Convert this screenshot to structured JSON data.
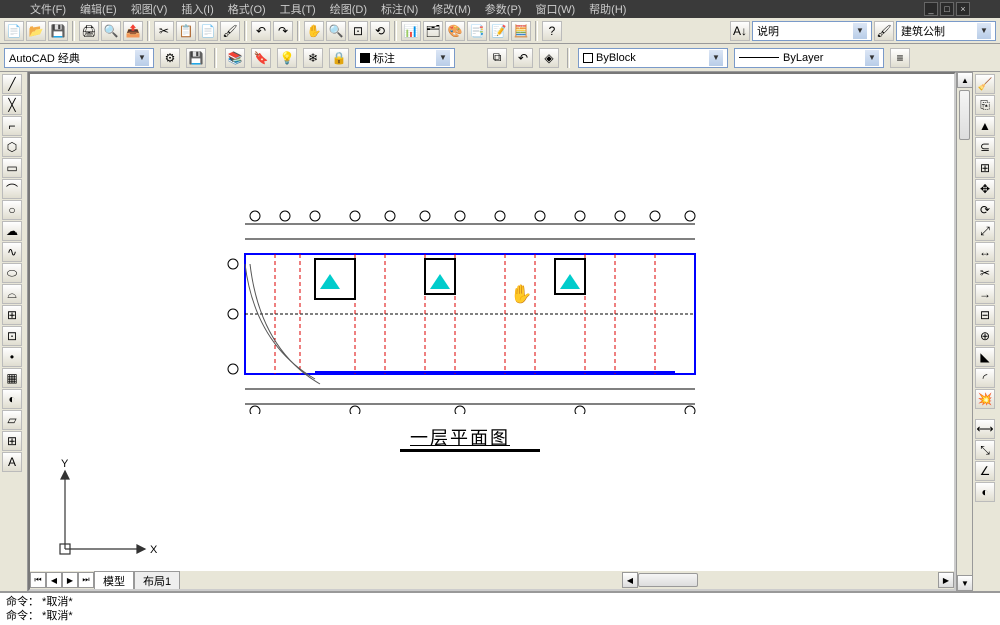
{
  "menu": {
    "file": "文件(F)",
    "edit": "编辑(E)",
    "view": "视图(V)",
    "insert": "插入(I)",
    "format": "格式(O)",
    "tools": "工具(T)",
    "draw": "绘图(D)",
    "dimension": "标注(N)",
    "modify": "修改(M)",
    "param": "参数(P)",
    "window": "窗口(W)",
    "help": "帮助(H)"
  },
  "toolbar2": {
    "workspace": "AutoCAD 经典",
    "dim_label": "标注",
    "linetype": "ByBlock",
    "lineweight": "ByLayer",
    "annotation": "说明",
    "style": "建筑公制"
  },
  "tabs": {
    "model": "模型",
    "layout1": "布局1"
  },
  "drawing": {
    "title": "一层平面图",
    "axis_x": "X",
    "axis_y": "Y"
  },
  "cmd": {
    "l1": "命令： *取消*",
    "l2": "命令： *取消*"
  }
}
